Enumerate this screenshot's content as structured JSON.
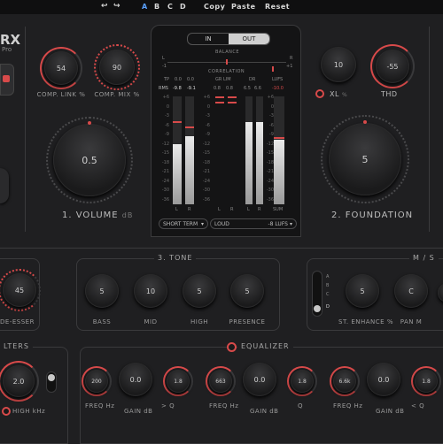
{
  "topbar": {
    "undo_icon": "undo-icon",
    "redo_icon": "redo-icon",
    "presets": [
      "A",
      "B",
      "C",
      "D"
    ],
    "active_preset": "A",
    "copy_label": "Copy",
    "paste_label": "Paste",
    "reset_label": "Reset"
  },
  "brand": {
    "title": "RX",
    "subtitle": "Pro"
  },
  "comp": {
    "link_value": "54",
    "link_label": "COMP. LINK %",
    "mix_value": "90",
    "mix_label": "COMP. MIX %"
  },
  "volume": {
    "value": "0.5",
    "label": "1. VOLUME",
    "unit": "dB"
  },
  "meter": {
    "tab_in": "IN",
    "tab_out": "OUT",
    "active_tab": "OUT",
    "balance_label": "BALANCE",
    "balance_l": "L",
    "balance_r": "R",
    "correlation_label": "CORRELATION",
    "corr_min": "-1",
    "corr_max": "+1",
    "tp_label": "TP",
    "tp_l": "0.0",
    "tp_r": "0.0",
    "rms_label": "RMS",
    "rms_l": "-9.8",
    "rms_r": "-9.1",
    "gr_lim_label": "GR LIM",
    "gr_lim_l": "0.8",
    "gr_lim_r": "0.8",
    "dr_label": "DR",
    "dr_l": "6.5",
    "dr_r": "6.6",
    "lufs_label": "LUFS",
    "lufs_value": "-10.0",
    "scale": [
      "+6",
      "0",
      "-3",
      "-6",
      "-9",
      "-12",
      "-15",
      "-18",
      "-21",
      "-24",
      "-30",
      "-36"
    ],
    "lr_l": "L",
    "lr_r": "R",
    "sum_label": "SUM",
    "short_term_select": "SHORT TERM",
    "loud_select": "LOUD",
    "loud_target": "-8 LUFS",
    "levels": {
      "peak_l": 0.56,
      "peak_r": 0.63,
      "dr_l": 0.76,
      "dr_r": 0.76,
      "sum": 0.6
    }
  },
  "xl": {
    "value": "10",
    "label": "XL",
    "unit": "%"
  },
  "thd": {
    "value": "-55",
    "label": "THD"
  },
  "foundation": {
    "value": "5",
    "label": "2. FOUNDATION"
  },
  "deesser": {
    "value": "45",
    "label": "DE-ESSER"
  },
  "tone": {
    "title": "3. TONE",
    "knobs": [
      {
        "value": "5",
        "label": "BASS"
      },
      {
        "value": "10",
        "label": "MID"
      },
      {
        "value": "5",
        "label": "HIGH"
      },
      {
        "value": "5",
        "label": "PRESENCE"
      }
    ]
  },
  "ms": {
    "title": "M / S",
    "modes": [
      "A",
      "B",
      "C",
      "D"
    ],
    "enhance_value": "5",
    "enhance_label": "ST. ENHANCE %",
    "pan_value": "C",
    "pan_label": "PAN M"
  },
  "filters": {
    "title": "LTERS",
    "value": "2.0",
    "label": "HIGH kHz"
  },
  "equalizer": {
    "title": "EQUALIZER",
    "bands": [
      {
        "freq": "200",
        "gain": "0.0",
        "q": "1.8"
      },
      {
        "freq": "663",
        "gain": "0.0",
        "q": "1.8"
      },
      {
        "freq": "6.6k",
        "gain": "0.0",
        "q": "1.8"
      }
    ],
    "freq_label": "FREQ Hz",
    "gain_label": "GAIN dB",
    "q_label": "Q"
  },
  "colors": {
    "accent": "#d84a4a",
    "preset_active": "#5aa0ff",
    "bg": "#1f1f21"
  }
}
